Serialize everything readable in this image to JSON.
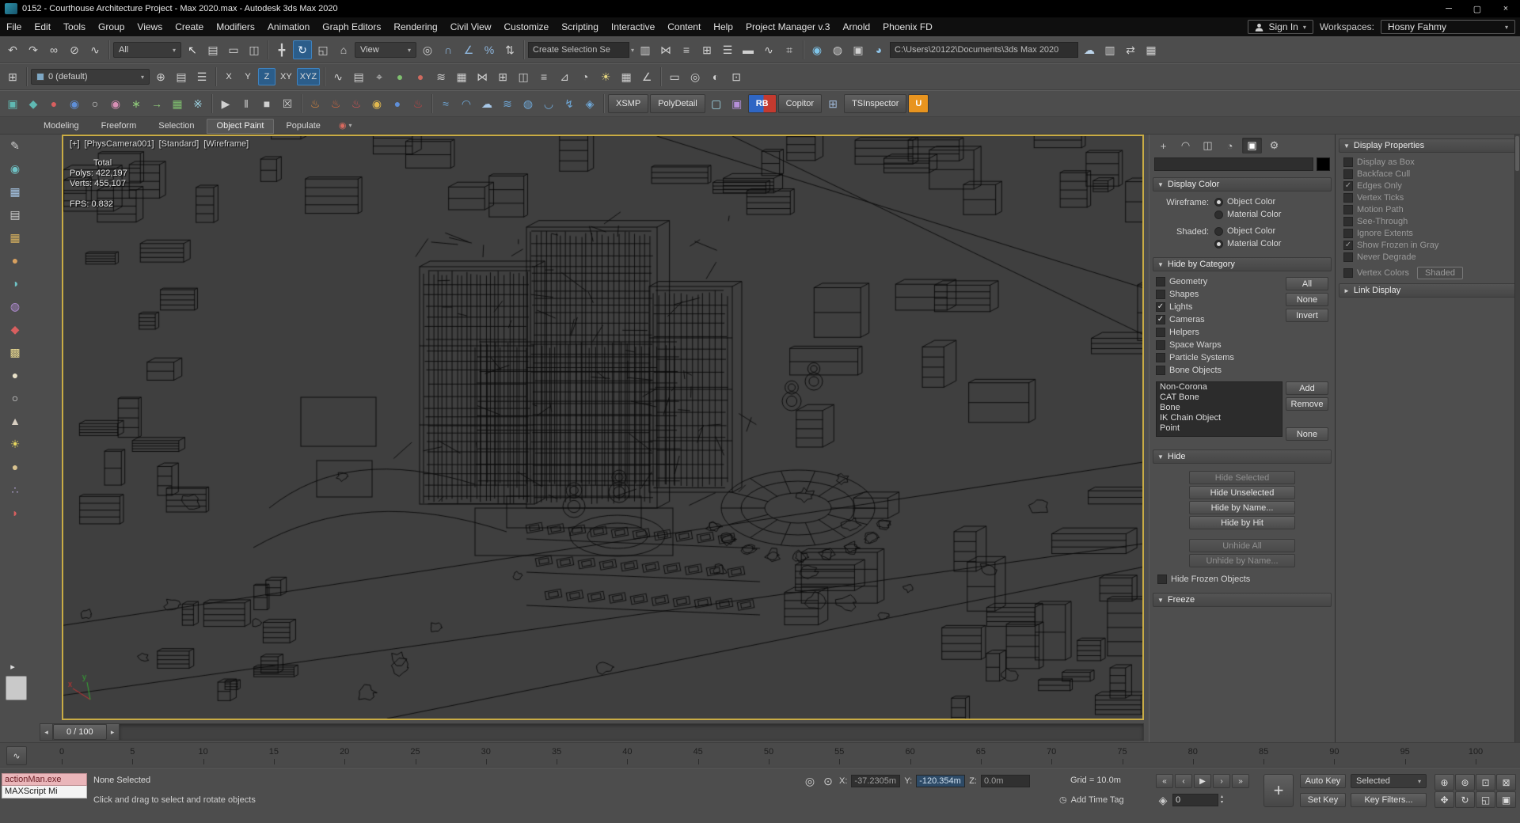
{
  "colors": {
    "accent": "#2b5d8a",
    "viewport_border": "#c9ac45",
    "viewport_bg": "#3f3f3f",
    "ui_bg": "#4d4d4d",
    "titlebar": "#000000",
    "wireframe": "#0a0a0a",
    "listener_pink": "#eab6ba"
  },
  "window": {
    "title": "0152 - Courthouse Architecture Project - Max 2020.max - Autodesk 3ds Max 2020",
    "controls": [
      {
        "n": "minimize-button",
        "g": "─"
      },
      {
        "n": "maximize-button",
        "g": "▢"
      },
      {
        "n": "close-button",
        "g": "×"
      }
    ]
  },
  "menu": {
    "items": [
      "File",
      "Edit",
      "Tools",
      "Group",
      "Views",
      "Create",
      "Modifiers",
      "Animation",
      "Graph Editors",
      "Rendering",
      "Civil View",
      "Customize",
      "Scripting",
      "Interactive",
      "Content",
      "Help",
      "Project Manager v.3",
      "Arnold",
      "Phoenix FD"
    ],
    "signin": "Sign In",
    "workspaces_label": "Workspaces:",
    "workspace": "Hosny Fahmy"
  },
  "toolbar1": {
    "iconsA": [
      {
        "n": "undo-icon",
        "g": "↶",
        "c": "#d0d0d0"
      },
      {
        "n": "redo-icon",
        "g": "↷",
        "c": "#d0d0d0"
      },
      {
        "n": "select-and-link-icon",
        "g": "∞",
        "c": "#d0d0d0"
      },
      {
        "n": "unlink-selection-icon",
        "g": "⊘",
        "c": "#d0d0d0"
      },
      {
        "n": "bind-to-space-warp-icon",
        "g": "∿",
        "c": "#d0d0d0"
      }
    ],
    "select_filter": "All",
    "iconsB": [
      {
        "n": "select-object-icon",
        "g": "↖",
        "c": "#e8e8e8"
      },
      {
        "n": "select-by-name-icon",
        "g": "▤",
        "c": "#d0d0d0"
      },
      {
        "n": "rectangular-selection-region-icon",
        "g": "▭",
        "c": "#d0d0d0"
      },
      {
        "n": "window-crossing-icon",
        "g": "◫",
        "c": "#d0d0d0"
      }
    ],
    "iconsC": [
      {
        "n": "select-and-move-icon",
        "g": "╋",
        "c": "#d0d0d0"
      },
      {
        "n": "select-and-rotate-icon",
        "g": "↻",
        "c": "#eaf4ff",
        "a": true
      },
      {
        "n": "select-and-scale-icon",
        "g": "◱",
        "c": "#d0d0d0"
      },
      {
        "n": "select-and-place-icon",
        "g": "⌂",
        "c": "#d0d0d0"
      }
    ],
    "view_dropdown": "View",
    "iconsD": [
      {
        "n": "use-pivot-point-icon",
        "g": "◎",
        "c": "#d0d0d0"
      },
      {
        "n": "snaps-toggle-icon",
        "g": "∩",
        "c": "#8fb8e0"
      },
      {
        "n": "angle-snap-icon",
        "g": "∠",
        "c": "#8fb8e0"
      },
      {
        "n": "percent-snap-icon",
        "g": "%",
        "c": "#8fb8e0"
      },
      {
        "n": "spinner-snap-icon",
        "g": "⇅",
        "c": "#d0d0d0"
      }
    ],
    "named_sel": "Create Selection Se",
    "iconsE": [
      {
        "n": "edit-named-selection-sets-icon",
        "g": "▥",
        "c": "#d0d0d0"
      },
      {
        "n": "mirror-icon",
        "g": "⋈",
        "c": "#d0d0d0"
      },
      {
        "n": "align-icon",
        "g": "≡",
        "c": "#d0d0d0"
      },
      {
        "n": "toggle-scene-explorer-icon",
        "g": "⊞",
        "c": "#d0d0d0"
      },
      {
        "n": "toggle-layer-explorer-icon",
        "g": "☰",
        "c": "#d0d0d0"
      },
      {
        "n": "toggle-ribbon-icon",
        "g": "▬",
        "c": "#d0d0d0"
      },
      {
        "n": "curve-editor-icon",
        "g": "∿",
        "c": "#d0d0d0"
      },
      {
        "n": "schematic-view-icon",
        "g": "⌗",
        "c": "#d0d0d0"
      }
    ],
    "iconsF": [
      {
        "n": "material-editor-icon",
        "g": "◉",
        "c": "#7fc4e8"
      },
      {
        "n": "render-setup-icon",
        "g": "◍",
        "c": "#d0d0d0"
      },
      {
        "n": "rendered-frame-window-icon",
        "g": "▣",
        "c": "#d0d0d0"
      },
      {
        "n": "render-production-icon",
        "g": "◕",
        "c": "#8fc4e8"
      }
    ],
    "path": "C:\\Users\\20122\\Documents\\3ds Max 2020",
    "iconsG": [
      {
        "n": "render-in-cloud-icon",
        "g": "☁",
        "c": "#bcd4ea"
      },
      {
        "n": "material-library-icon",
        "g": "▥",
        "c": "#d0d0d0"
      },
      {
        "n": "scene-converter-icon",
        "g": "⇄",
        "c": "#d0d0d0"
      },
      {
        "n": "workspace-icon",
        "g": "▦",
        "c": "#d0d0d0"
      }
    ]
  },
  "toolbar2": {
    "iconsA": [
      {
        "n": "scene-explorer-toggle-icon",
        "g": "⊞",
        "c": "#d0d0d0"
      }
    ],
    "layer": "0 (default)",
    "iconsB": [
      {
        "n": "create-new-layer-icon",
        "g": "⊕",
        "c": "#d0d0d0"
      },
      {
        "n": "layer-properties-icon",
        "g": "▤",
        "c": "#d0d0d0"
      },
      {
        "n": "select-objects-in-layer-icon",
        "g": "☰",
        "c": "#d0d0d0"
      }
    ],
    "axes": [
      {
        "label": "X"
      },
      {
        "label": "Y"
      },
      {
        "label": "Z",
        "active": true
      },
      {
        "label": "XY"
      },
      {
        "label": "XYZ",
        "active": true
      }
    ],
    "iconsC": [
      {
        "n": "track-view-icon",
        "g": "∿",
        "c": "#d0d0d0"
      },
      {
        "n": "dope-sheet-icon",
        "g": "▤",
        "c": "#d0d0d0"
      },
      {
        "n": "crosshair-icon",
        "g": "⌖",
        "c": "#d0d0d0"
      },
      {
        "n": "green-status-icon",
        "g": "●",
        "c": "#7fbf6f"
      },
      {
        "n": "red-status-icon",
        "g": "●",
        "c": "#cf6a5f"
      },
      {
        "n": "statistics-icon",
        "g": "≋",
        "c": "#d0d0d0"
      },
      {
        "n": "viewport-config-icon",
        "g": "▦",
        "c": "#d0d0d0"
      },
      {
        "n": "mirror-tool-icon",
        "g": "⋈",
        "c": "#d0d0d0"
      },
      {
        "n": "array-icon",
        "g": "⊞",
        "c": "#d0d0d0"
      },
      {
        "n": "snapshot-icon",
        "g": "◫",
        "c": "#d0d0d0"
      },
      {
        "n": "align-tool-icon",
        "g": "≡",
        "c": "#d0d0d0"
      },
      {
        "n": "normal-align-icon",
        "g": "⊿",
        "c": "#d0d0d0"
      },
      {
        "n": "camera-icon",
        "g": "◔",
        "c": "#d0d0d0"
      },
      {
        "n": "light-icon",
        "g": "☀",
        "c": "#e8d87f"
      },
      {
        "n": "grid-icon",
        "g": "▦",
        "c": "#d0d0d0"
      },
      {
        "n": "measure-icon",
        "g": "∠",
        "c": "#d0d0d0"
      }
    ],
    "iconsD": [
      {
        "n": "keyboard-override-icon",
        "g": "▭",
        "c": "#d0d0d0"
      },
      {
        "n": "isolate-icon",
        "g": "◎",
        "c": "#d0d0d0"
      },
      {
        "n": "display-filter-icon",
        "g": "◐",
        "c": "#d0d0d0"
      },
      {
        "n": "misc-tool-icon",
        "g": "⊡",
        "c": "#d0d0d0"
      }
    ]
  },
  "toolbar3": {
    "iconsA": [
      {
        "n": "plugin-cube-icon",
        "g": "▣",
        "c": "#5fb8b2"
      },
      {
        "n": "plugin-diamond-icon",
        "g": "◆",
        "c": "#5fb8b2"
      },
      {
        "n": "plugin-red-sphere-icon",
        "g": "●",
        "c": "#d85f5f"
      },
      {
        "n": "plugin-blue-drop-icon",
        "g": "◉",
        "c": "#5f8fd8"
      },
      {
        "n": "plugin-ring-icon",
        "g": "○",
        "c": "#d0d0d0"
      },
      {
        "n": "plugin-pink-icon",
        "g": "◉",
        "c": "#d88fb5"
      },
      {
        "n": "plugin-leaf-icon",
        "g": "∗",
        "c": "#8fc97a"
      },
      {
        "n": "plugin-arrow-icon",
        "g": "→",
        "c": "#8fc97a"
      },
      {
        "n": "plugin-grid-icon",
        "g": "▦",
        "c": "#7fbf6f"
      },
      {
        "n": "plugin-burst-icon",
        "g": "※",
        "c": "#9fd8e8"
      }
    ],
    "iconsB": [
      {
        "n": "play-preview-icon",
        "g": "▶",
        "c": "#d0d0d0"
      },
      {
        "n": "pause-preview-icon",
        "g": "‖",
        "c": "#d0d0d0"
      },
      {
        "n": "stop-preview-icon",
        "g": "■",
        "c": "#d0d0d0"
      },
      {
        "n": "delete-animation-icon",
        "g": "☒",
        "c": "#d0d0d0"
      }
    ],
    "iconsC": [
      {
        "n": "fire-effect-icon",
        "g": "♨",
        "c": "#e08a3f"
      },
      {
        "n": "flame-tool-icon",
        "g": "♨",
        "c": "#e0693f"
      },
      {
        "n": "blaze-tool-icon",
        "g": "♨",
        "c": "#d85555"
      },
      {
        "n": "ember-icon",
        "g": "◉",
        "c": "#e0b84f"
      },
      {
        "n": "liquid-icon",
        "g": "●",
        "c": "#5f8fd8"
      },
      {
        "n": "explosion-icon",
        "g": "♨",
        "c": "#c24545"
      }
    ],
    "iconsD": [
      {
        "n": "ocean-wave-icon",
        "g": "≈",
        "c": "#6fa8d8"
      },
      {
        "n": "wave-arc-icon",
        "g": "◠",
        "c": "#6fa8d8"
      },
      {
        "n": "cloud-sim-icon",
        "g": "☁",
        "c": "#a8c8e8"
      },
      {
        "n": "ripple-icon",
        "g": "≋",
        "c": "#6fa8d8"
      },
      {
        "n": "foam-icon",
        "g": "◍",
        "c": "#6fa8d8"
      },
      {
        "n": "splash-icon",
        "g": "◡",
        "c": "#6fa8d8"
      },
      {
        "n": "lightning-icon",
        "g": "↯",
        "c": "#6fa8d8"
      },
      {
        "n": "gem-icon",
        "g": "◈",
        "c": "#6fa8d8"
      }
    ],
    "xsmp": "XSMP",
    "polydetail": "PolyDetail",
    "iconsE": [
      {
        "n": "monitor-plugin-icon",
        "g": "▢",
        "c": "#9fd8e8"
      },
      {
        "n": "purple-plugin-icon",
        "g": "▣",
        "c": "#b58fd8"
      }
    ],
    "rb": "RB",
    "copitor": "Copitor",
    "iconsF": [
      {
        "n": "grid-plugin-icon",
        "g": "⊞",
        "c": "#9fb8d8"
      }
    ],
    "tsinspector": "TSInspector",
    "u": "U"
  },
  "ribbon": {
    "tabs": [
      {
        "label": "Modeling"
      },
      {
        "label": "Freeform"
      },
      {
        "label": "Selection"
      },
      {
        "label": "Object Paint",
        "active": true
      },
      {
        "label": "Populate"
      }
    ],
    "config_glyph": "◉"
  },
  "left_tools": [
    {
      "n": "left-toolbar-icon-1",
      "g": "✎",
      "c": "#cfcfcf"
    },
    {
      "n": "left-toolbar-icon-2",
      "g": "◉",
      "c": "#6fc2c5"
    },
    {
      "n": "left-toolbar-icon-3",
      "g": "▦",
      "c": "#a8c8e8"
    },
    {
      "n": "left-toolbar-icon-4",
      "g": "▤",
      "c": "#cfcfcf"
    },
    {
      "n": "left-toolbar-icon-5",
      "g": "▦",
      "c": "#d8b25f"
    },
    {
      "n": "left-toolbar-icon-6",
      "g": "●",
      "c": "#d8a05f"
    },
    {
      "n": "left-toolbar-icon-7",
      "g": "◑",
      "c": "#6fc2c5"
    },
    {
      "n": "left-toolbar-icon-8",
      "g": "◍",
      "c": "#b58fd8"
    },
    {
      "n": "left-toolbar-icon-9",
      "g": "◆",
      "c": "#d85f5f"
    },
    {
      "n": "left-toolbar-icon-10",
      "g": "▩",
      "c": "#e8d88f"
    },
    {
      "n": "left-toolbar-icon-11",
      "g": "●",
      "c": "#e8e0c8"
    },
    {
      "n": "left-toolbar-icon-12",
      "g": "○",
      "c": "#e8e8e8"
    },
    {
      "n": "left-toolbar-icon-13",
      "g": "▲",
      "c": "#d8cfc2"
    },
    {
      "n": "left-toolbar-icon-14",
      "g": "☀",
      "c": "#e8d85f"
    },
    {
      "n": "left-toolbar-icon-15",
      "g": "●",
      "c": "#d8c28f"
    },
    {
      "n": "left-toolbar-icon-16",
      "g": "∴",
      "c": "#b5a8d8"
    },
    {
      "n": "left-toolbar-icon-17",
      "g": "◗",
      "c": "#d85f5f"
    }
  ],
  "viewport": {
    "overlays": {
      "plus": "[+]",
      "camera": "[PhysCamera001]",
      "style": "[Standard]",
      "shading": "[Wireframe]"
    },
    "stats": {
      "total": "Total",
      "polys": "Polys: 422,197",
      "verts": "Verts: 455,107",
      "fps": "FPS: 0.832"
    }
  },
  "command_panel": {
    "tabs": [
      {
        "n": "create-tab-icon",
        "g": "+"
      },
      {
        "n": "modify-tab-icon",
        "g": "◠"
      },
      {
        "n": "hierarchy-tab-icon",
        "g": "◫"
      },
      {
        "n": "motion-tab-icon",
        "g": "◔"
      },
      {
        "n": "display-tab-icon",
        "g": "▣",
        "a": true
      },
      {
        "n": "utilities-tab-icon",
        "g": "⚙"
      }
    ],
    "display_color": {
      "title": "Display Color",
      "wireframe_label": "Wireframe:",
      "shaded_label": "Shaded:",
      "object_color": "Object Color",
      "material_color": "Material Color"
    },
    "hide_by_category": {
      "title": "Hide by Category",
      "checks": [
        {
          "label": "Geometry"
        },
        {
          "label": "Shapes"
        },
        {
          "label": "Lights",
          "checked": true
        },
        {
          "label": "Cameras",
          "checked": true
        },
        {
          "label": "Helpers"
        },
        {
          "label": "Space Warps"
        },
        {
          "label": "Particle Systems"
        },
        {
          "label": "Bone Objects"
        }
      ],
      "side_buttons": [
        "All",
        "None",
        "Invert"
      ],
      "list": [
        "Non-Corona",
        "CAT Bone",
        "Bone",
        "IK Chain Object",
        "Point"
      ],
      "list_buttons": [
        "Add",
        "Remove",
        "None"
      ]
    },
    "hide": {
      "title": "Hide",
      "buttons": [
        {
          "label": "Hide Selected",
          "disabled": true
        },
        {
          "label": "Hide Unselected"
        },
        {
          "label": "Hide by Name..."
        },
        {
          "label": "Hide by Hit"
        }
      ],
      "buttons2": [
        {
          "label": "Unhide All",
          "disabled": true
        },
        {
          "label": "Unhide by Name...",
          "disabled": true
        }
      ],
      "frozen_check": [
        {
          "label": "Hide Frozen Objects"
        }
      ]
    },
    "freeze": {
      "title": "Freeze"
    }
  },
  "display_panel": {
    "title": "Display Properties",
    "checks": [
      {
        "label": "Display as Box",
        "disabled": true
      },
      {
        "label": "Backface Cull",
        "disabled": true
      },
      {
        "label": "Edges Only",
        "checked": true,
        "disabled": true
      },
      {
        "label": "Vertex Ticks",
        "disabled": true
      },
      {
        "label": "Motion Path",
        "disabled": true
      },
      {
        "label": "See-Through",
        "disabled": true
      },
      {
        "label": "Ignore Extents",
        "disabled": true
      },
      {
        "label": "Show Frozen in Gray",
        "checked": true,
        "disabled": true
      },
      {
        "label": "Never Degrade",
        "disabled": true
      }
    ],
    "vertex_colors_label": "Vertex Colors",
    "shaded_button": "Shaded",
    "link_display": "Link Display"
  },
  "time_slider": {
    "value": "0 / 100"
  },
  "timeline": {
    "start": 0,
    "end": 100,
    "step": 5
  },
  "status": {
    "listener1": "actionMan.exe",
    "listener2": "MAXScript Mi",
    "selection": "None Selected",
    "prompt": "Click and drag to select and rotate objects",
    "x_label": "X:",
    "x": "-37.2305m",
    "y_label": "Y:",
    "y": "-120.354m",
    "z_label": "Z:",
    "z": "0.0m",
    "grid": "Grid = 10.0m",
    "add_time_tag": "Add Time Tag"
  },
  "anim": {
    "auto_key": "Auto Key",
    "set_key": "Set Key",
    "selected": "Selected",
    "key_filters": "Key Filters...",
    "frame": "0",
    "key_button": "+",
    "playback": [
      {
        "n": "go-to-start-button",
        "g": "«"
      },
      {
        "n": "previous-frame-button",
        "g": "‹"
      },
      {
        "n": "play-button",
        "g": "▶"
      },
      {
        "n": "next-frame-button",
        "g": "›"
      },
      {
        "n": "go-to-end-button",
        "g": "»"
      }
    ],
    "nav": [
      {
        "n": "zoom-icon",
        "g": "⊕"
      },
      {
        "n": "zoom-all-icon",
        "g": "⊚"
      },
      {
        "n": "zoom-extents-icon",
        "g": "⊡"
      },
      {
        "n": "zoom-region-icon",
        "g": "⊠"
      },
      {
        "n": "pan-view-icon",
        "g": "✥"
      },
      {
        "n": "orbit-icon",
        "g": "↻"
      },
      {
        "n": "maximize-viewport-toggle-icon",
        "g": "◱"
      },
      {
        "n": "viewport-layout-icon",
        "g": "▣"
      }
    ]
  }
}
